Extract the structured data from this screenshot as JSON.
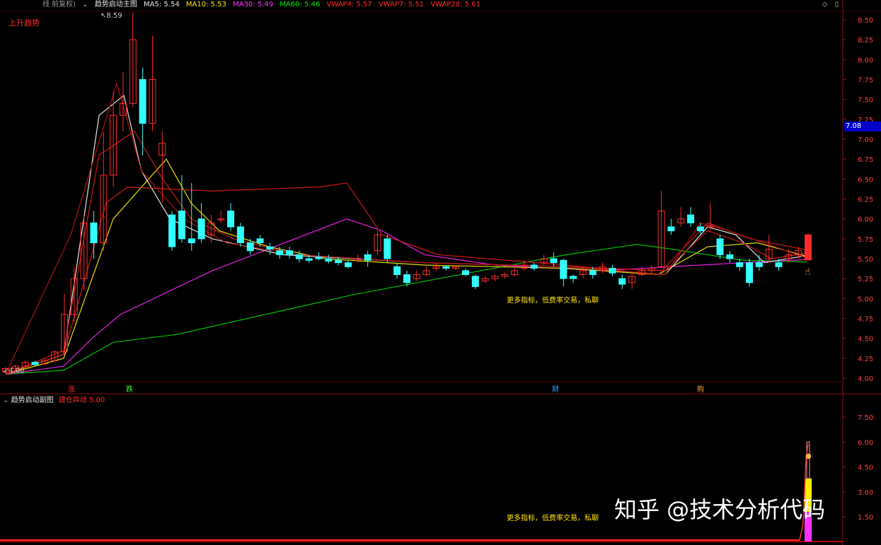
{
  "main_panel": {
    "header": {
      "prefix_label": "线 前复权)",
      "indicator_name": "趋势启动主图",
      "ma_items": [
        {
          "label": "MA5: 5.54",
          "color": "#e6e6e6"
        },
        {
          "label": "MA10: 5.53",
          "color": "#ffe600"
        },
        {
          "label": "MA30: 5.49",
          "color": "#ff33ff"
        },
        {
          "label": "MA60: 5.46",
          "color": "#00e600"
        },
        {
          "label": "VWAP4: 5.57",
          "color": "#ff2a2a"
        },
        {
          "label": "VWAP7: 5.51",
          "color": "#ff2a2a"
        },
        {
          "label": "VWAP28: 5.61",
          "color": "#ff2a2a"
        }
      ]
    },
    "trend_label": "上升趋势",
    "annotation": "更多指标，低费率交易，私聊",
    "high_marker": "8.59",
    "low_marker": "4.08",
    "event_markers": [
      "涨",
      "跌",
      "财",
      "购"
    ],
    "y_ticks": [
      "8.50",
      "8.25",
      "8.00",
      "7.75",
      "7.50",
      "7.25",
      "7.00",
      "6.75",
      "6.50",
      "6.25",
      "6.00",
      "5.75",
      "5.50",
      "5.25",
      "5.00",
      "4.75",
      "4.50",
      "4.25",
      "4.00"
    ],
    "price_tag": "7.08"
  },
  "sub_panel": {
    "header": {
      "indicator_name": "趋势启动副图",
      "signal_label": "建仓异动",
      "signal_value": "5.00"
    },
    "annotation": "更多指标，低费率交易，私聊",
    "y_ticks": [
      "7.50",
      "6.00",
      "4.50",
      "3.00",
      "1.50"
    ]
  },
  "watermark": "知乎 @技术分析代码",
  "colors": {
    "up": "#ff2a2a",
    "down": "#33ffff",
    "axis": "#8a1010",
    "tick_text": "#ff4040"
  }
}
